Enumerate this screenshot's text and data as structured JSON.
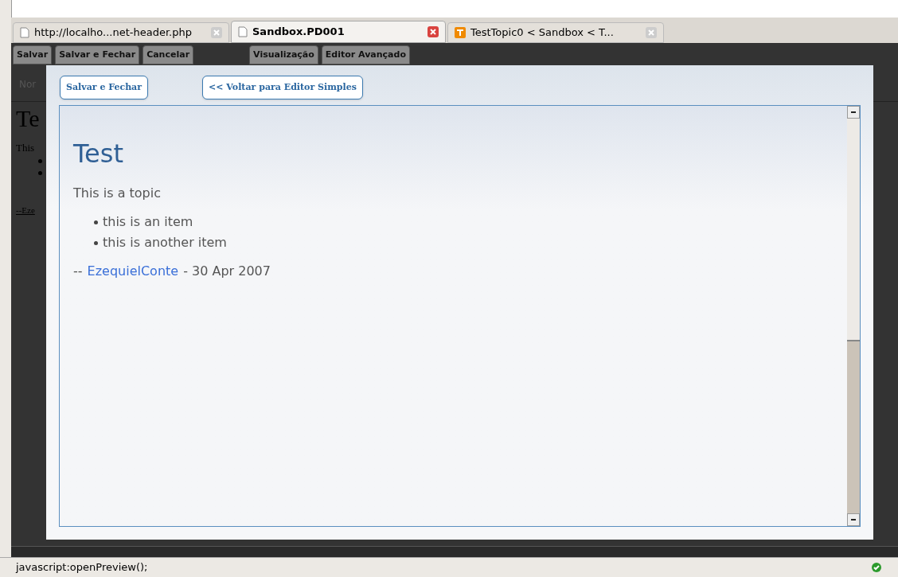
{
  "tabs": [
    {
      "label": "http://localho...net-header.php",
      "selected": false,
      "kind": "page"
    },
    {
      "label": "Sandbox.PD001",
      "selected": true,
      "kind": "page"
    },
    {
      "label": "TestTopic0 < Sandbox < T...",
      "selected": false,
      "kind": "site"
    }
  ],
  "toolbar": {
    "buttons": [
      "Salvar",
      "Salvar e Fechar",
      "Cancelar",
      "Visualização",
      "Editor Avançado"
    ],
    "format_select": "Nor"
  },
  "background_page": {
    "heading": "Te",
    "paragraph": "This",
    "signature": "--Eze"
  },
  "dialog": {
    "buttons": [
      "Salvar e Fechar",
      "<< Voltar para Editor Simples"
    ],
    "preview": {
      "title": "Test",
      "paragraph": "This is a topic",
      "items": [
        "this is an item",
        "this is another item"
      ],
      "signature_prefix": "--",
      "author": "EzequielConte",
      "date": "- 30 Apr 2007"
    }
  },
  "status_bar": {
    "text": "javascript:openPreview();"
  }
}
